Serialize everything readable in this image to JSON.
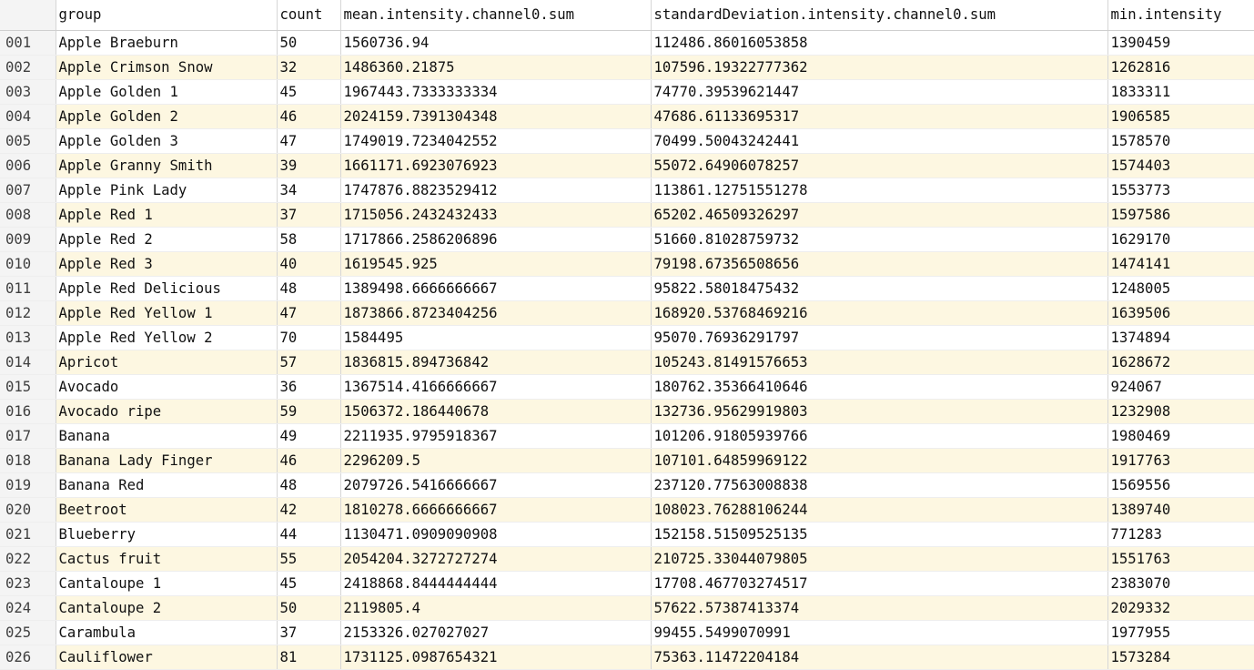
{
  "columns": {
    "group": "group",
    "count": "count",
    "mean": "mean.intensity.channel0.sum",
    "std": "standardDeviation.intensity.channel0.sum",
    "min": "min.intensity"
  },
  "rows": [
    {
      "idx": "001",
      "group": "Apple Braeburn",
      "count": "50",
      "mean": "1560736.94",
      "std": "112486.86016053858",
      "min": "1390459"
    },
    {
      "idx": "002",
      "group": "Apple Crimson Snow",
      "count": "32",
      "mean": "1486360.21875",
      "std": "107596.19322777362",
      "min": "1262816"
    },
    {
      "idx": "003",
      "group": "Apple Golden 1",
      "count": "45",
      "mean": "1967443.7333333334",
      "std": "74770.39539621447",
      "min": "1833311"
    },
    {
      "idx": "004",
      "group": "Apple Golden 2",
      "count": "46",
      "mean": "2024159.7391304348",
      "std": "47686.61133695317",
      "min": "1906585"
    },
    {
      "idx": "005",
      "group": "Apple Golden 3",
      "count": "47",
      "mean": "1749019.7234042552",
      "std": "70499.50043242441",
      "min": "1578570"
    },
    {
      "idx": "006",
      "group": "Apple Granny Smith",
      "count": "39",
      "mean": "1661171.6923076923",
      "std": "55072.64906078257",
      "min": "1574403"
    },
    {
      "idx": "007",
      "group": "Apple Pink Lady",
      "count": "34",
      "mean": "1747876.8823529412",
      "std": "113861.12751551278",
      "min": "1553773"
    },
    {
      "idx": "008",
      "group": "Apple Red 1",
      "count": "37",
      "mean": "1715056.2432432433",
      "std": "65202.46509326297",
      "min": "1597586"
    },
    {
      "idx": "009",
      "group": "Apple Red 2",
      "count": "58",
      "mean": "1717866.2586206896",
      "std": "51660.81028759732",
      "min": "1629170"
    },
    {
      "idx": "010",
      "group": "Apple Red 3",
      "count": "40",
      "mean": "1619545.925",
      "std": "79198.67356508656",
      "min": "1474141"
    },
    {
      "idx": "011",
      "group": "Apple Red Delicious",
      "count": "48",
      "mean": "1389498.6666666667",
      "std": "95822.58018475432",
      "min": "1248005"
    },
    {
      "idx": "012",
      "group": "Apple Red Yellow 1",
      "count": "47",
      "mean": "1873866.8723404256",
      "std": "168920.53768469216",
      "min": "1639506"
    },
    {
      "idx": "013",
      "group": "Apple Red Yellow 2",
      "count": "70",
      "mean": "1584495",
      "std": "95070.76936291797",
      "min": "1374894"
    },
    {
      "idx": "014",
      "group": "Apricot",
      "count": "57",
      "mean": "1836815.894736842",
      "std": "105243.81491576653",
      "min": "1628672"
    },
    {
      "idx": "015",
      "group": "Avocado",
      "count": "36",
      "mean": "1367514.4166666667",
      "std": "180762.35366410646",
      "min": "924067"
    },
    {
      "idx": "016",
      "group": "Avocado ripe",
      "count": "59",
      "mean": "1506372.186440678",
      "std": "132736.95629919803",
      "min": "1232908"
    },
    {
      "idx": "017",
      "group": "Banana",
      "count": "49",
      "mean": "2211935.9795918367",
      "std": "101206.91805939766",
      "min": "1980469"
    },
    {
      "idx": "018",
      "group": "Banana Lady Finger",
      "count": "46",
      "mean": "2296209.5",
      "std": "107101.64859969122",
      "min": "1917763"
    },
    {
      "idx": "019",
      "group": "Banana Red",
      "count": "48",
      "mean": "2079726.5416666667",
      "std": "237120.77563008838",
      "min": "1569556"
    },
    {
      "idx": "020",
      "group": "Beetroot",
      "count": "42",
      "mean": "1810278.6666666667",
      "std": "108023.76288106244",
      "min": "1389740"
    },
    {
      "idx": "021",
      "group": "Blueberry",
      "count": "44",
      "mean": "1130471.0909090908",
      "std": "152158.51509525135",
      "min": "771283"
    },
    {
      "idx": "022",
      "group": "Cactus fruit",
      "count": "55",
      "mean": "2054204.3272727274",
      "std": "210725.33044079805",
      "min": "1551763"
    },
    {
      "idx": "023",
      "group": "Cantaloupe 1",
      "count": "45",
      "mean": "2418868.8444444444",
      "std": "17708.467703274517",
      "min": "2383070"
    },
    {
      "idx": "024",
      "group": "Cantaloupe 2",
      "count": "50",
      "mean": "2119805.4",
      "std": "57622.57387413374",
      "min": "2029332"
    },
    {
      "idx": "025",
      "group": "Carambula",
      "count": "37",
      "mean": "2153326.027027027",
      "std": "99455.5499070991",
      "min": "1977955"
    },
    {
      "idx": "026",
      "group": "Cauliflower",
      "count": "81",
      "mean": "1731125.0987654321",
      "std": "75363.11472204184",
      "min": "1573284"
    }
  ]
}
